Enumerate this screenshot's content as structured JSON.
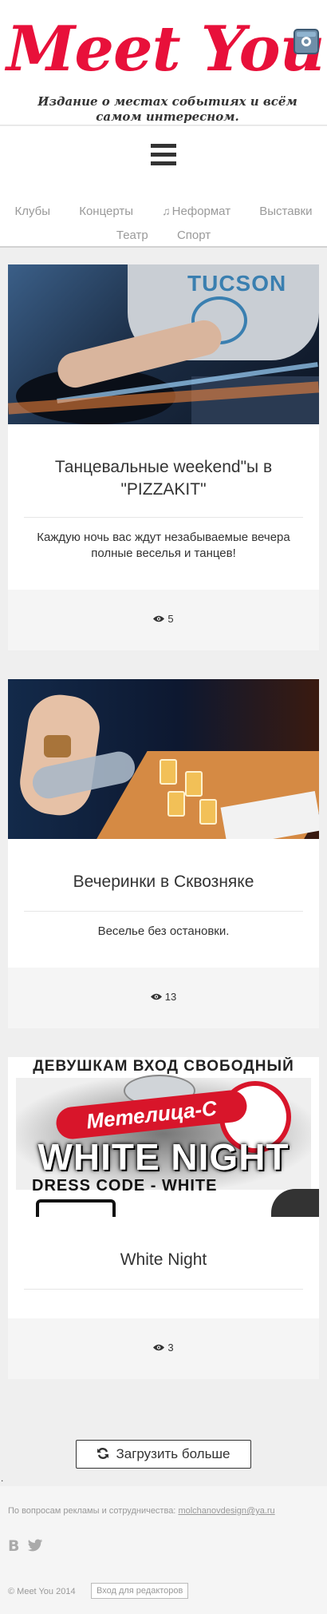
{
  "header": {
    "logo": "Meet You",
    "tagline": "Издание о местах событиях и всём самом интересном.",
    "instagram_icon": "instagram-icon"
  },
  "nav": {
    "menu_icon": "hamburger-icon",
    "row1": [
      "Клубы",
      "Концерты",
      "Неформат",
      "Выставки"
    ],
    "row2": [
      "Театр",
      "Спорт"
    ],
    "music_icon": "♫"
  },
  "posts": [
    {
      "title": "Танцевальные weekend\"ы в \"PIZZAKIT\"",
      "description": "Каждую ночь вас ждут незабываемые вечера полные веселья и танцев!",
      "views": "5",
      "image_text": "TUCSON"
    },
    {
      "title": "Вечеринки в Сквозняке",
      "description": "Веселье без остановки.",
      "views": "13"
    },
    {
      "title": "White Night",
      "description": "",
      "views": "3",
      "poster": {
        "top_text": "ДЕВУШКАМ ВХОД СВОБОДНЫЙ",
        "brand": "Метелица-С",
        "headline": "WHITE NIGHT",
        "dress_code": "DRESS CODE - WHITE"
      }
    }
  ],
  "load_more": {
    "label": "Загрузить больше"
  },
  "stray_dot": ".",
  "footer": {
    "contact_text": "По вопросам рекламы и сотрудничества:",
    "contact_email": "molchanovdesign@ya.ru",
    "vk_label": "B",
    "copyright": "© Meet You 2014",
    "editor_login": "Вход для редакторов"
  },
  "colors": {
    "brand_red": "#e8103a",
    "background": "#efefef",
    "card_footer": "#f5f5f5"
  }
}
